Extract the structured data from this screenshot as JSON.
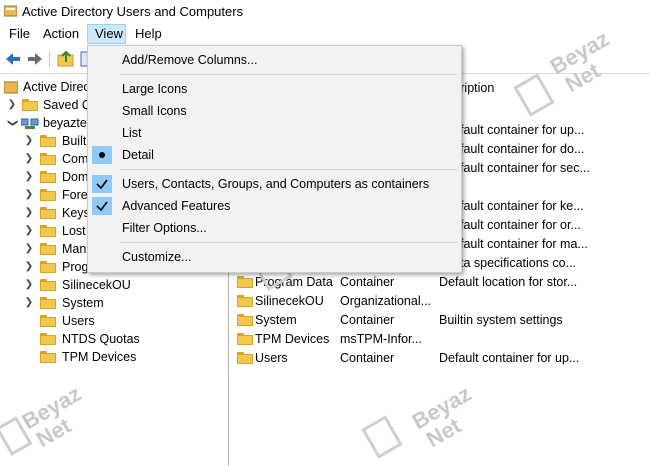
{
  "window": {
    "title": "Active Directory Users and Computers"
  },
  "menubar": {
    "items": [
      "File",
      "Action",
      "View",
      "Help"
    ],
    "active": "View"
  },
  "tree": {
    "root": "Active Directo",
    "saved": "Saved Q",
    "domain": "beyazte",
    "children": [
      "Built",
      "Com",
      "Dom",
      "Fore",
      "Keys",
      "Lost",
      "Man",
      "Program Data",
      "SilinecekOU",
      "System",
      "Users",
      "NTDS Quotas",
      "TPM Devices"
    ]
  },
  "list": {
    "header_description": "cription",
    "partial_rows": [
      "fault container for up...",
      "fault container for do...",
      "fault container for sec...",
      "fault container for ke...",
      "fault container for or...",
      "fault container for ma...",
      "ta specifications co..."
    ],
    "rows": [
      {
        "name": "Program Data",
        "type": "Container",
        "desc": "Default location for stor..."
      },
      {
        "name": "SilinecekOU",
        "type": "Organizational...",
        "desc": ""
      },
      {
        "name": "System",
        "type": "Container",
        "desc": "Builtin system settings"
      },
      {
        "name": "TPM Devices",
        "type": "msTPM-Infor...",
        "desc": ""
      },
      {
        "name": "Users",
        "type": "Container",
        "desc": "Default container for up..."
      }
    ]
  },
  "view_menu": {
    "add_remove": "Add/Remove Columns...",
    "large_icons": "Large Icons",
    "small_icons": "Small Icons",
    "list": "List",
    "detail": "Detail",
    "users_contacts": "Users, Contacts, Groups, and Computers as containers",
    "advanced": "Advanced Features",
    "filter": "Filter Options...",
    "customize": "Customize..."
  },
  "watermark": {
    "line1": "Beyaz",
    "line2": "Net"
  },
  "colors": {
    "menu_highlight": "#cce8ff",
    "check_bg": "#91c9f7",
    "folder": "#f4c84e"
  }
}
